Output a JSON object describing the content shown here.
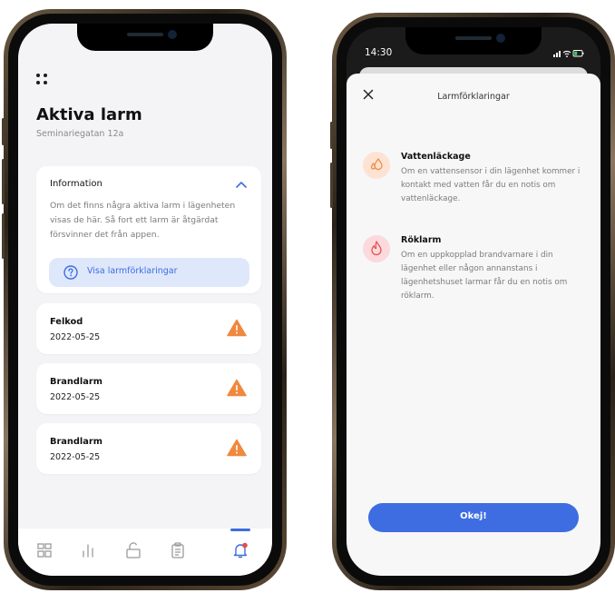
{
  "left_phone": {
    "header": {
      "title": "Aktiva larm",
      "address": "Seminariegatan 12a"
    },
    "information": {
      "title": "Information",
      "text": "Om det finns några aktiva larm i lägenheten visas de här. Så fort ett larm är åtgärdat försvinner det från appen.",
      "button_label": "Visa larmförklaringar"
    },
    "alarms": [
      {
        "title": "Felkod",
        "date": "2022-05-25",
        "icon": "warning-icon"
      },
      {
        "title": "Brandlarm",
        "date": "2022-05-25",
        "icon": "warning-icon"
      },
      {
        "title": "Brandlarm",
        "date": "2022-05-25",
        "icon": "warning-icon"
      }
    ],
    "tabbar": {
      "items": [
        "grid-icon",
        "chart-icon",
        "unlock-icon",
        "clipboard-icon",
        "bell-icon"
      ],
      "active": "bell-icon"
    }
  },
  "right_phone": {
    "status_bar": {
      "time": "14:30"
    },
    "sheet": {
      "title": "Larmförklaringar",
      "items": [
        {
          "title": "Vattenläckage",
          "text": "Om en vattensensor i din lägenhet kommer i kontakt med vatten får du en notis om vattenläckage.",
          "icon": "water-drops-icon"
        },
        {
          "title": "Röklarm",
          "text": "Om en uppkopplad brandvarnare i din lägenhet eller någon annanstans i lägenhetshuset larmar får du en notis om röklarm.",
          "icon": "flame-icon"
        }
      ],
      "confirm_label": "Okej!"
    }
  },
  "colors": {
    "accent": "#3d6de0",
    "accent_light": "#dfe7fb",
    "warning": "#f0883e",
    "water_bg": "#fde3d3",
    "flame_bg": "#fbd9dc"
  }
}
